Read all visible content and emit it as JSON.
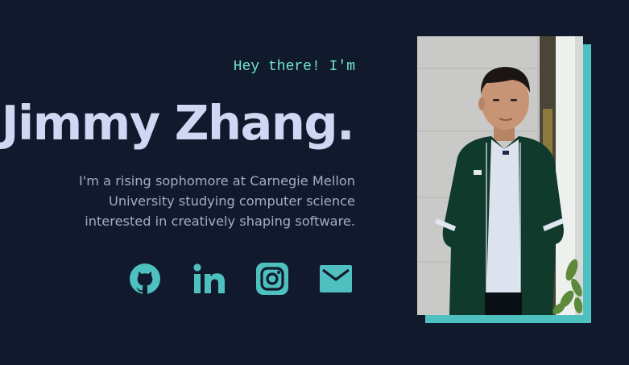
{
  "hero": {
    "greeting": "Hey there! I'm",
    "name": "Jimmy Zhang.",
    "bio_lines": [
      "I'm a rising sophomore at Carnegie Mellon",
      "University studying computer science",
      "interested in creatively shaping software."
    ]
  },
  "social_links": [
    {
      "icon": "github-icon",
      "label": "GitHub"
    },
    {
      "icon": "linkedin-icon",
      "label": "LinkedIn"
    },
    {
      "icon": "instagram-icon",
      "label": "Instagram"
    },
    {
      "icon": "mail-icon",
      "label": "Email"
    }
  ],
  "colors": {
    "background": "#111a2c",
    "accent": "#4fc0c0",
    "greeting": "#6fe6c8",
    "name": "#cfd7f3",
    "bio": "#a3acc6"
  },
  "photo": {
    "alt": "Portrait photo"
  }
}
